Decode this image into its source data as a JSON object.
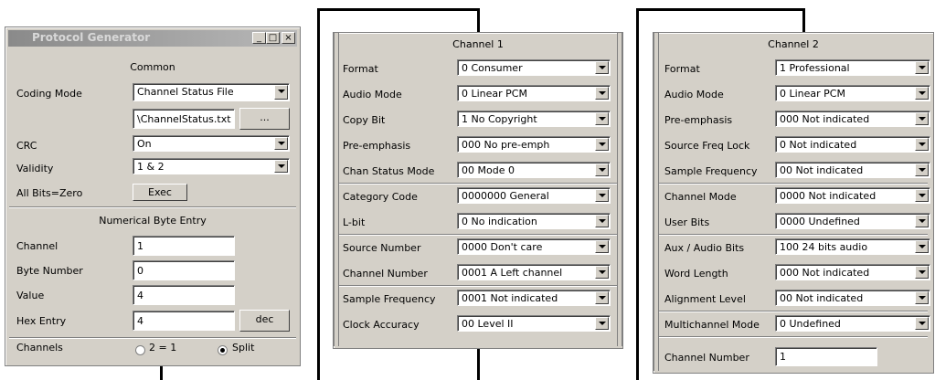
{
  "protocol_generator": {
    "title": "Protocol Generator",
    "window_buttons": {
      "minimize": "_",
      "maximize": "□",
      "close": "×"
    },
    "common_header": "Common",
    "coding_mode": {
      "label": "Coding Mode",
      "value": "Channel Status File"
    },
    "file_path": {
      "value": "\\ChannelStatus.txt",
      "browse_label": "..."
    },
    "crc": {
      "label": "CRC",
      "value": "On"
    },
    "validity": {
      "label": "Validity",
      "value": "1 & 2"
    },
    "all_bits_zero": {
      "label": "All Bits=Zero",
      "button": "Exec"
    },
    "numerical_header": "Numerical Byte Entry",
    "channel": {
      "label": "Channel",
      "value": "1"
    },
    "byte_number": {
      "label": "Byte Number",
      "value": "0"
    },
    "value": {
      "label": "Value",
      "value": "4"
    },
    "hex_entry": {
      "label": "Hex Entry",
      "value": "4",
      "button": "dec"
    },
    "channels": {
      "label": "Channels",
      "option1": "2 = 1",
      "option2": "Split",
      "selected": "Split"
    }
  },
  "channel1": {
    "header": "Channel 1",
    "rows": [
      {
        "label": "Format",
        "value": "0  Consumer"
      },
      {
        "label": "Audio Mode",
        "value": "0  Linear PCM"
      },
      {
        "label": "Copy Bit",
        "value": "1  No Copyright"
      },
      {
        "label": "Pre-emphasis",
        "value": "000  No pre-emph"
      },
      {
        "label": "Chan Status Mode",
        "value": "00  Mode 0"
      },
      {
        "label": "Category Code",
        "value": "0000000  General"
      },
      {
        "label": "L-bit",
        "value": "0  No indication"
      },
      {
        "label": "Source Number",
        "value": "0000  Don't care"
      },
      {
        "label": "Channel Number",
        "value": "0001  A Left channel"
      },
      {
        "label": "Sample Frequency",
        "value": "0001  Not indicated"
      },
      {
        "label": "Clock Accuracy",
        "value": "00  Level II"
      }
    ]
  },
  "channel2": {
    "header": "Channel 2",
    "rows": [
      {
        "label": "Format",
        "value": "1  Professional"
      },
      {
        "label": "Audio Mode",
        "value": "0  Linear PCM"
      },
      {
        "label": "Pre-emphasis",
        "value": "000  Not indicated"
      },
      {
        "label": "Source Freq Lock",
        "value": "0  Not indicated"
      },
      {
        "label": "Sample Frequency",
        "value": "00  Not indicated"
      },
      {
        "label": "Channel Mode",
        "value": "0000  Not indicated"
      },
      {
        "label": "User Bits",
        "value": "0000  Undefined"
      },
      {
        "label": "Aux / Audio Bits",
        "value": "100  24 bits audio"
      },
      {
        "label": "Word Length",
        "value": "000  Not indicated"
      },
      {
        "label": "Alignment Level",
        "value": "00  Not indicated"
      },
      {
        "label": "Multichannel Mode",
        "value": "0  Undefined"
      }
    ],
    "channel_number": {
      "label": "Channel Number",
      "value": "1"
    }
  }
}
